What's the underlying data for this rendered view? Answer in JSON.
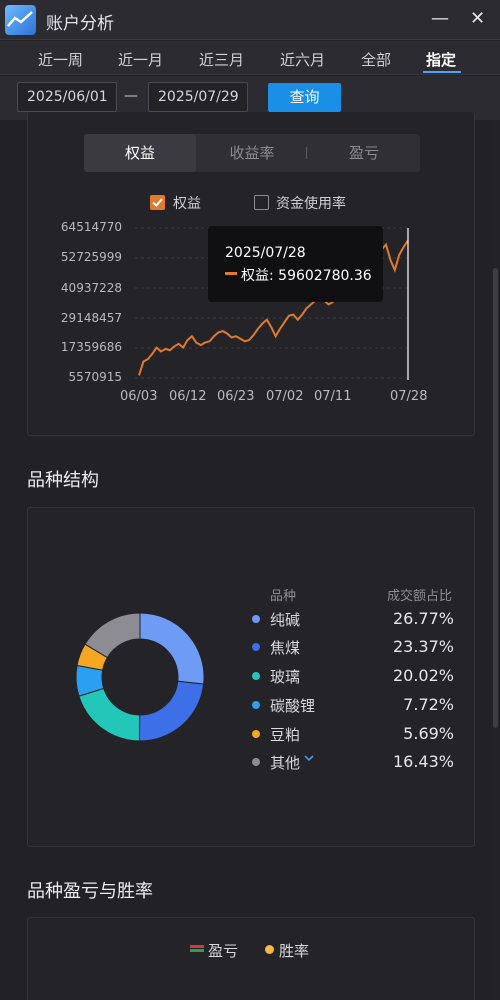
{
  "window": {
    "title": "账户分析",
    "minimize": "—",
    "close": "✕"
  },
  "tabs": [
    {
      "label": "近一周"
    },
    {
      "label": "近一月"
    },
    {
      "label": "近三月"
    },
    {
      "label": "近六月"
    },
    {
      "label": "全部"
    },
    {
      "label": "指定",
      "active": true
    }
  ],
  "filter": {
    "start_date": "2025/06/01",
    "separator": "—",
    "end_date": "2025/07/29",
    "query_label": "查询"
  },
  "equity_section": {
    "segments": [
      {
        "label": "权益",
        "active": true
      },
      {
        "label": "收益率"
      },
      {
        "label": "盈亏"
      }
    ],
    "checkboxes": [
      {
        "label": "权益",
        "checked": true
      },
      {
        "label": "资金使用率",
        "checked": false
      }
    ],
    "tooltip": {
      "date": "2025/07/28",
      "series": "权益",
      "value": "59602780.36"
    },
    "accent_color": "#e07a2c"
  },
  "chart_data": [
    {
      "type": "line",
      "title": "",
      "xlabel": "",
      "ylabel": "",
      "y_ticks": [
        "64514770",
        "52725999",
        "40937228",
        "29148457",
        "17359686",
        "5570915"
      ],
      "ylim": [
        5570915,
        64514770
      ],
      "x_ticks": [
        "06/03",
        "06/12",
        "06/23",
        "07/02",
        "07/11",
        "07/28"
      ],
      "grid": true,
      "series": [
        {
          "name": "权益",
          "color": "#e07a2c",
          "values": [
            6600000,
            12000000,
            13000000,
            15000000,
            17500000,
            16000000,
            17000000,
            16500000,
            18000000,
            19000000,
            17500000,
            20500000,
            22000000,
            19500000,
            18500000,
            19500000,
            20000000,
            22000000,
            23500000,
            24000000,
            23000000,
            21500000,
            22000000,
            21000000,
            20000000,
            20500000,
            22500000,
            25000000,
            27000000,
            28500000,
            25500000,
            22000000,
            25000000,
            27500000,
            30000000,
            30500000,
            28500000,
            30500000,
            33000000,
            34500000,
            36000000,
            36500000,
            36000000,
            34500000,
            35500000,
            39000000,
            42000000,
            44000000,
            46000000,
            48000000,
            47000000,
            49000000,
            52000000,
            50000000,
            53000000,
            56000000,
            58000000,
            52000000,
            48000000,
            54000000,
            57000000,
            59602780
          ]
        }
      ]
    },
    {
      "type": "pie",
      "title": "品种结构",
      "legend_headers": [
        "品种",
        "成交额占比"
      ],
      "categories": [
        "纯碱",
        "焦煤",
        "玻璃",
        "碳酸锂",
        "豆粕",
        "其他"
      ],
      "values": [
        26.77,
        23.37,
        20.02,
        7.72,
        5.69,
        16.43
      ],
      "labels": [
        "26.77%",
        "23.37%",
        "20.02%",
        "7.72%",
        "5.69%",
        "16.43%"
      ],
      "colors": [
        "#6e9cf5",
        "#3d6fe8",
        "#22c7b9",
        "#2b9ff2",
        "#f5a623",
        "#8c8c92"
      ]
    }
  ],
  "structure_section": {
    "title": "品种结构",
    "expand_icon": "chevron-down-icon"
  },
  "pnl_section": {
    "title": "品种盈亏与胜率",
    "legend": [
      {
        "label": "盈亏",
        "color": "#d43a3a",
        "color2": "#2e9e4d"
      },
      {
        "label": "胜率",
        "color": "#f5b74a"
      }
    ]
  }
}
